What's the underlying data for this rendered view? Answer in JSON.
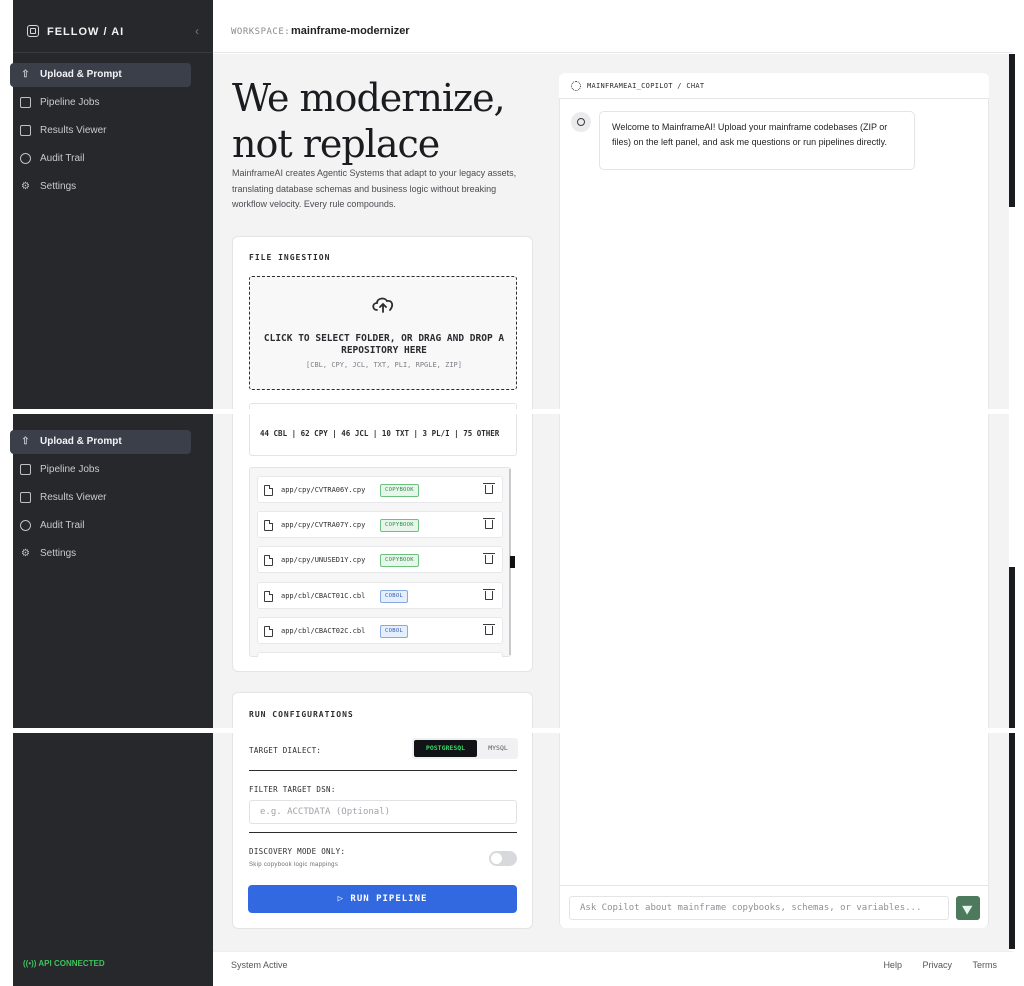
{
  "brand": {
    "name": "FELLOW / AI",
    "collapse_icon": "chevron-left-icon"
  },
  "nav": {
    "items": [
      {
        "label": "Upload & Prompt",
        "icon": "upload-icon",
        "active": true
      },
      {
        "label": "Pipeline Jobs",
        "icon": "database-icon",
        "active": false
      },
      {
        "label": "Results Viewer",
        "icon": "document-icon",
        "active": false
      },
      {
        "label": "Audit Trail",
        "icon": "history-icon",
        "active": false
      },
      {
        "label": "Settings",
        "icon": "gear-icon",
        "active": false
      }
    ]
  },
  "status": {
    "api": "API CONNECTED",
    "system": "System Active"
  },
  "workspace": {
    "label": "WORKSPACE:",
    "name": "mainframe-modernizer"
  },
  "hero": {
    "title_line1": "We modernize,",
    "title_line2": "not replace",
    "description": "MainframeAI creates Agentic Systems that adapt to your legacy assets, translating database schemas and business logic without breaking workflow velocity. Every rule compounds."
  },
  "ingestion": {
    "label": "FILE INGESTION",
    "drop_text": "CLICK TO SELECT FOLDER, OR DRAG AND DROP A REPOSITORY HERE",
    "drop_types": "[CBL, CPY, JCL, TXT, PLI, RPGLE, ZIP]",
    "counts": "44 CBL | 62 CPY | 46 JCL | 10 TXT | 3 PL/I | 75 OTHER",
    "files": [
      {
        "name": "app/cpy/CVTRA06Y.cpy",
        "type": "COPYBOOK"
      },
      {
        "name": "app/cpy/CVTRA07Y.cpy",
        "type": "COPYBOOK"
      },
      {
        "name": "app/cpy/UNUSED1Y.cpy",
        "type": "COPYBOOK"
      },
      {
        "name": "app/cbl/CBACT01C.cbl",
        "type": "COBOL"
      },
      {
        "name": "app/cbl/CBACT02C.cbl",
        "type": "COBOL"
      }
    ]
  },
  "config": {
    "label": "RUN CONFIGURATIONS",
    "dialect_label": "TARGET DIALECT:",
    "dialect_options": [
      "POSTGRESQL",
      "MYSQL"
    ],
    "dialect_selected": "POSTGRESQL",
    "dsn_label": "FILTER TARGET DSN:",
    "dsn_placeholder": "e.g. ACCTDATA (Optional)",
    "dsn_value": "",
    "discovery_label": "DISCOVERY MODE ONLY:",
    "discovery_hint": "Skip copybook logic mappings",
    "discovery_enabled": false,
    "run_label": "▷ RUN PIPELINE"
  },
  "chat": {
    "title": "MAINFRAMEAI_COPILOT / CHAT",
    "welcome": "Welcome to MainframeAI! Upload your mainframe codebases (ZIP or files) on the left panel, and ask me questions or run pipelines directly.",
    "input_placeholder": "Ask Copilot about mainframe copybooks, schemas, or variables..."
  },
  "footer": {
    "links": [
      "Help",
      "Privacy",
      "Terms"
    ]
  },
  "colors": {
    "sidebar": "#27282b",
    "accent_blue": "#3268e0",
    "accent_green": "#3ec25d",
    "send_green": "#4d7a5d"
  }
}
